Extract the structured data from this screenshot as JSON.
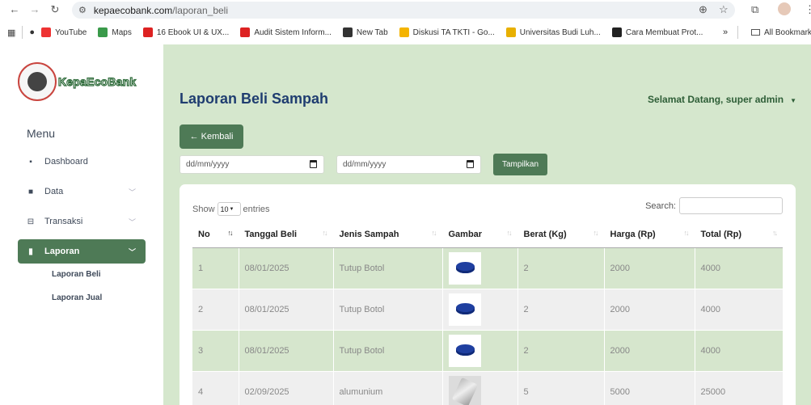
{
  "browser": {
    "url_host": "kepaecobank.com",
    "url_path": "/laporan_beli",
    "bookmarks": [
      {
        "label": "YouTube",
        "color": "#e33"
      },
      {
        "label": "Maps",
        "color": "#3a9a4a"
      },
      {
        "label": "16 Ebook UI & UX...",
        "color": "#d22"
      },
      {
        "label": "Audit Sistem Inform...",
        "color": "#d22"
      },
      {
        "label": "New Tab",
        "color": "#333"
      },
      {
        "label": "Diskusi TA TKTI - Go...",
        "color": "#f4b400"
      },
      {
        "label": "Universitas Budi Luh...",
        "color": "#e8b000"
      },
      {
        "label": "Cara Membuat Prot...",
        "color": "#222"
      }
    ],
    "more_bookmarks": "»",
    "all_bookmarks": "All Bookmarks"
  },
  "sidebar": {
    "logo_text": "KepaEcoBank",
    "menu_title": "Menu",
    "items": [
      {
        "label": "Dashboard",
        "icon": "grid-icon",
        "glyph": "▪"
      },
      {
        "label": "Data",
        "icon": "briefcase-icon",
        "glyph": "■"
      },
      {
        "label": "Transaksi",
        "icon": "cart-icon",
        "glyph": "⊟"
      },
      {
        "label": "Laporan",
        "icon": "file-icon",
        "glyph": "▮"
      }
    ],
    "sub_items": [
      "Laporan Beli",
      "Laporan Jual"
    ]
  },
  "header": {
    "page_title": "Laporan Beli Sampah",
    "welcome": "Selamat Datang, super admin"
  },
  "filters": {
    "back_label": "← Kembali",
    "start_date_placeholder": "dd/mm/yyyy",
    "end_date_placeholder": "dd/mm/yyyy",
    "show_label": "Tampilkan"
  },
  "table": {
    "show_prefix": "Show",
    "entries_value": "10",
    "show_suffix": "entries",
    "search_label": "Search:",
    "columns": [
      "No",
      "Tanggal Beli",
      "Jenis Sampah",
      "Gambar",
      "Berat (Kg)",
      "Harga (Rp)",
      "Total (Rp)"
    ],
    "rows": [
      {
        "no": "1",
        "tanggal": "08/01/2025",
        "jenis": "Tutup Botol",
        "gambar": "bottle-cap-image",
        "berat": "2",
        "harga": "2000",
        "total": "4000"
      },
      {
        "no": "2",
        "tanggal": "08/01/2025",
        "jenis": "Tutup Botol",
        "gambar": "bottle-cap-image",
        "berat": "2",
        "harga": "2000",
        "total": "4000"
      },
      {
        "no": "3",
        "tanggal": "08/01/2025",
        "jenis": "Tutup Botol",
        "gambar": "bottle-cap-image",
        "berat": "2",
        "harga": "2000",
        "total": "4000"
      },
      {
        "no": "4",
        "tanggal": "02/09/2025",
        "jenis": "alumunium",
        "gambar": "aluminium-can-image",
        "berat": "5",
        "harga": "5000",
        "total": "25000"
      }
    ]
  }
}
